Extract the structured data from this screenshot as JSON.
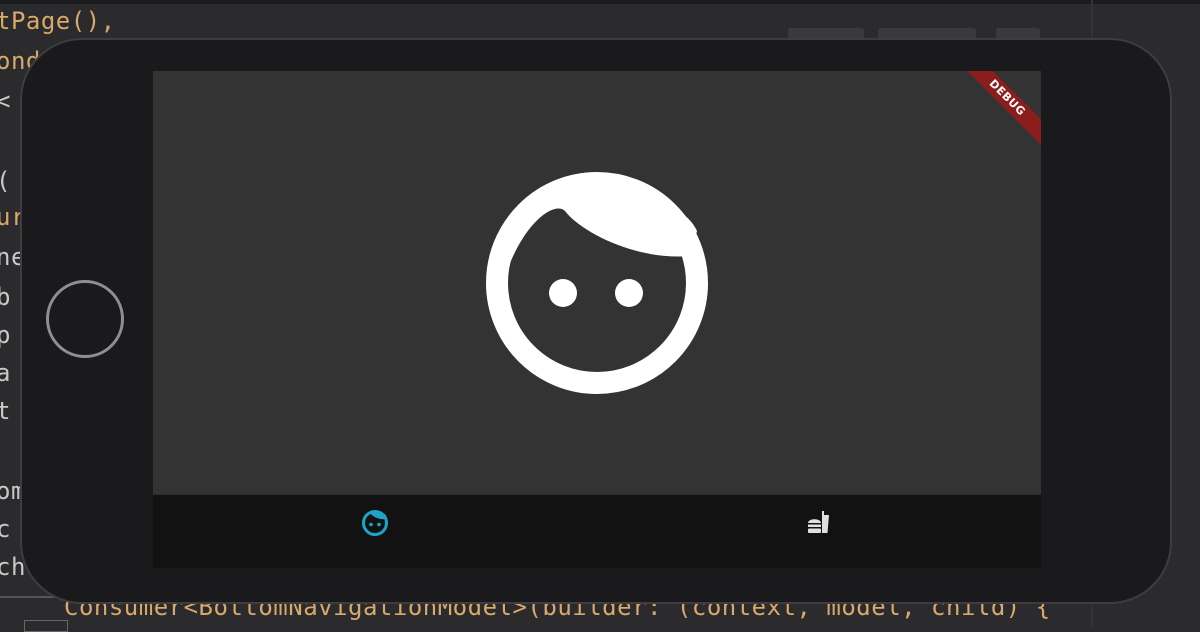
{
  "editor": {
    "lines": [
      "tPage(),",
      "ondP",
      "<",
      "",
      "(",
      "ur",
      "ne",
      "b",
      "p",
      "a",
      "t",
      "",
      "om",
      "c",
      "ch"
    ],
    "bottom_line": "Consumer<BottomNavigationModel>(builder: (context, model, child) {"
  },
  "app": {
    "debug_banner": "DEBUG",
    "content_icon": "face-icon",
    "bottom_nav": {
      "items": [
        {
          "icon": "face-icon",
          "selected": true
        },
        {
          "icon": "fastfood-icon",
          "selected": false
        }
      ]
    }
  },
  "colors": {
    "screen_bg": "#333333",
    "nav_bg": "#121212",
    "accent": "#1ea4c4",
    "icon_inactive": "#e0e0e0",
    "debug_banner": "#8c1d1d",
    "code_orange": "#d9a86b"
  }
}
